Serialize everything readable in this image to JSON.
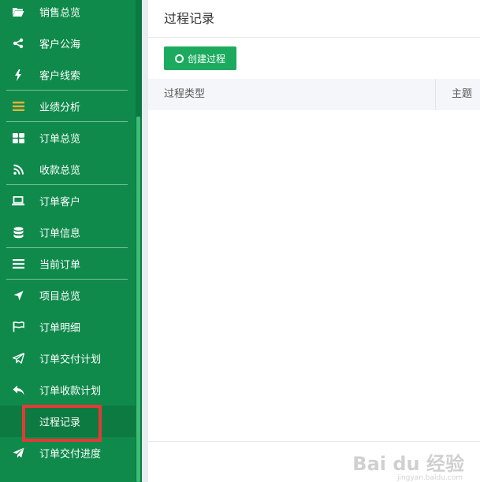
{
  "sidebar": {
    "items": [
      {
        "label": "销售总览",
        "icon": "folder-open-icon"
      },
      {
        "label": "客户公海",
        "icon": "share-icon"
      },
      {
        "label": "客户线索",
        "icon": "bolt-icon"
      },
      {
        "label": "业绩分析",
        "icon": "bars-icon"
      },
      {
        "label": "订单总览",
        "icon": "grid-icon"
      },
      {
        "label": "收款总览",
        "icon": "rss-icon"
      },
      {
        "label": "订单客户",
        "icon": "laptop-icon"
      },
      {
        "label": "订单信息",
        "icon": "database-icon"
      },
      {
        "label": "当前订单",
        "icon": "list-icon"
      },
      {
        "label": "项目总览",
        "icon": "location-arrow-icon"
      },
      {
        "label": "订单明细",
        "icon": "flag-icon"
      },
      {
        "label": "订单交付计划",
        "icon": "paper-plane-outline-icon"
      },
      {
        "label": "订单收款计划",
        "icon": "reply-icon"
      },
      {
        "label": "过程记录",
        "icon": ""
      },
      {
        "label": "订单交付进度",
        "icon": "paper-plane-icon"
      }
    ],
    "active_label": "过程记录"
  },
  "main": {
    "title": "过程记录",
    "create_button": "创建过程",
    "columns": [
      "过程类型",
      "主题"
    ]
  },
  "watermark": {
    "text": "Bai du 经验",
    "sub": "jingyan.baidu.com"
  },
  "colors": {
    "sidebar_bg": "#0f8a4b",
    "button": "#1cab5e",
    "highlight": "#e53935"
  }
}
